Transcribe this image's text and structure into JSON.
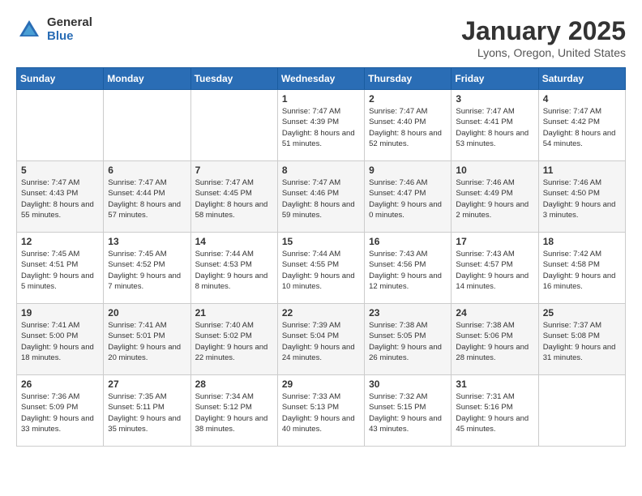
{
  "header": {
    "logo_general": "General",
    "logo_blue": "Blue",
    "title": "January 2025",
    "location": "Lyons, Oregon, United States"
  },
  "days_of_week": [
    "Sunday",
    "Monday",
    "Tuesday",
    "Wednesday",
    "Thursday",
    "Friday",
    "Saturday"
  ],
  "weeks": [
    [
      {
        "day": "",
        "info": ""
      },
      {
        "day": "",
        "info": ""
      },
      {
        "day": "",
        "info": ""
      },
      {
        "day": "1",
        "info": "Sunrise: 7:47 AM\nSunset: 4:39 PM\nDaylight: 8 hours and 51 minutes."
      },
      {
        "day": "2",
        "info": "Sunrise: 7:47 AM\nSunset: 4:40 PM\nDaylight: 8 hours and 52 minutes."
      },
      {
        "day": "3",
        "info": "Sunrise: 7:47 AM\nSunset: 4:41 PM\nDaylight: 8 hours and 53 minutes."
      },
      {
        "day": "4",
        "info": "Sunrise: 7:47 AM\nSunset: 4:42 PM\nDaylight: 8 hours and 54 minutes."
      }
    ],
    [
      {
        "day": "5",
        "info": "Sunrise: 7:47 AM\nSunset: 4:43 PM\nDaylight: 8 hours and 55 minutes."
      },
      {
        "day": "6",
        "info": "Sunrise: 7:47 AM\nSunset: 4:44 PM\nDaylight: 8 hours and 57 minutes."
      },
      {
        "day": "7",
        "info": "Sunrise: 7:47 AM\nSunset: 4:45 PM\nDaylight: 8 hours and 58 minutes."
      },
      {
        "day": "8",
        "info": "Sunrise: 7:47 AM\nSunset: 4:46 PM\nDaylight: 8 hours and 59 minutes."
      },
      {
        "day": "9",
        "info": "Sunrise: 7:46 AM\nSunset: 4:47 PM\nDaylight: 9 hours and 0 minutes."
      },
      {
        "day": "10",
        "info": "Sunrise: 7:46 AM\nSunset: 4:49 PM\nDaylight: 9 hours and 2 minutes."
      },
      {
        "day": "11",
        "info": "Sunrise: 7:46 AM\nSunset: 4:50 PM\nDaylight: 9 hours and 3 minutes."
      }
    ],
    [
      {
        "day": "12",
        "info": "Sunrise: 7:45 AM\nSunset: 4:51 PM\nDaylight: 9 hours and 5 minutes."
      },
      {
        "day": "13",
        "info": "Sunrise: 7:45 AM\nSunset: 4:52 PM\nDaylight: 9 hours and 7 minutes."
      },
      {
        "day": "14",
        "info": "Sunrise: 7:44 AM\nSunset: 4:53 PM\nDaylight: 9 hours and 8 minutes."
      },
      {
        "day": "15",
        "info": "Sunrise: 7:44 AM\nSunset: 4:55 PM\nDaylight: 9 hours and 10 minutes."
      },
      {
        "day": "16",
        "info": "Sunrise: 7:43 AM\nSunset: 4:56 PM\nDaylight: 9 hours and 12 minutes."
      },
      {
        "day": "17",
        "info": "Sunrise: 7:43 AM\nSunset: 4:57 PM\nDaylight: 9 hours and 14 minutes."
      },
      {
        "day": "18",
        "info": "Sunrise: 7:42 AM\nSunset: 4:58 PM\nDaylight: 9 hours and 16 minutes."
      }
    ],
    [
      {
        "day": "19",
        "info": "Sunrise: 7:41 AM\nSunset: 5:00 PM\nDaylight: 9 hours and 18 minutes."
      },
      {
        "day": "20",
        "info": "Sunrise: 7:41 AM\nSunset: 5:01 PM\nDaylight: 9 hours and 20 minutes."
      },
      {
        "day": "21",
        "info": "Sunrise: 7:40 AM\nSunset: 5:02 PM\nDaylight: 9 hours and 22 minutes."
      },
      {
        "day": "22",
        "info": "Sunrise: 7:39 AM\nSunset: 5:04 PM\nDaylight: 9 hours and 24 minutes."
      },
      {
        "day": "23",
        "info": "Sunrise: 7:38 AM\nSunset: 5:05 PM\nDaylight: 9 hours and 26 minutes."
      },
      {
        "day": "24",
        "info": "Sunrise: 7:38 AM\nSunset: 5:06 PM\nDaylight: 9 hours and 28 minutes."
      },
      {
        "day": "25",
        "info": "Sunrise: 7:37 AM\nSunset: 5:08 PM\nDaylight: 9 hours and 31 minutes."
      }
    ],
    [
      {
        "day": "26",
        "info": "Sunrise: 7:36 AM\nSunset: 5:09 PM\nDaylight: 9 hours and 33 minutes."
      },
      {
        "day": "27",
        "info": "Sunrise: 7:35 AM\nSunset: 5:11 PM\nDaylight: 9 hours and 35 minutes."
      },
      {
        "day": "28",
        "info": "Sunrise: 7:34 AM\nSunset: 5:12 PM\nDaylight: 9 hours and 38 minutes."
      },
      {
        "day": "29",
        "info": "Sunrise: 7:33 AM\nSunset: 5:13 PM\nDaylight: 9 hours and 40 minutes."
      },
      {
        "day": "30",
        "info": "Sunrise: 7:32 AM\nSunset: 5:15 PM\nDaylight: 9 hours and 43 minutes."
      },
      {
        "day": "31",
        "info": "Sunrise: 7:31 AM\nSunset: 5:16 PM\nDaylight: 9 hours and 45 minutes."
      },
      {
        "day": "",
        "info": ""
      }
    ]
  ]
}
